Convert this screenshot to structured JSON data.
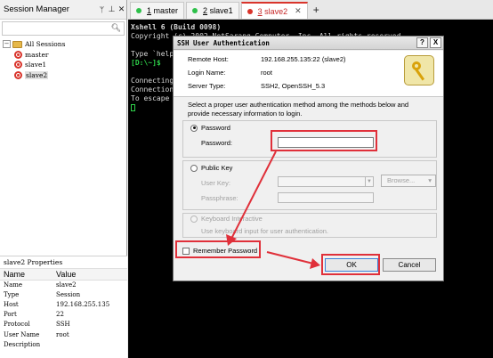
{
  "session_manager": {
    "title": "Session Manager",
    "pin_glyph": "ᛘ",
    "pin2_glyph": "⊥",
    "close_glyph": "✕",
    "search_placeholder": "",
    "tree": {
      "root_label": "All Sessions",
      "root_expander": "−",
      "items": [
        {
          "label": "master",
          "selected": false
        },
        {
          "label": "slave1",
          "selected": false
        },
        {
          "label": "slave2",
          "selected": true
        }
      ]
    },
    "properties": {
      "title": "slave2 Properties",
      "col_name": "Name",
      "col_value": "Value",
      "rows": [
        {
          "name": "Name",
          "value": "slave2"
        },
        {
          "name": "Type",
          "value": "Session"
        },
        {
          "name": "Host",
          "value": "192.168.255.135"
        },
        {
          "name": "Port",
          "value": "22"
        },
        {
          "name": "Protocol",
          "value": "SSH"
        },
        {
          "name": "User Name",
          "value": "root"
        },
        {
          "name": "Description",
          "value": ""
        }
      ]
    }
  },
  "tabs": [
    {
      "number": "1",
      "name": "master",
      "dot_color": "#2ec04a",
      "active": false
    },
    {
      "number": "2",
      "name": "slave1",
      "dot_color": "#2ec04a",
      "active": false
    },
    {
      "number": "3",
      "name": "slave2",
      "dot_color": "#d9342b",
      "active": true
    }
  ],
  "tab_add": "+",
  "tab_close_glyph": "✕",
  "terminal": {
    "lines": [
      {
        "text": "Xshell 6 (Build 0098)",
        "style": "bold"
      },
      {
        "text": "Copyright (c) 2002 NetSarang Computer, Inc. All rights reserved.",
        "style": ""
      },
      {
        "text": "",
        "style": ""
      },
      {
        "text": "Type `help' to learn how to use Xshell prompt.",
        "style": ""
      },
      {
        "text": "[D:\\~]$",
        "style": "green"
      },
      {
        "text": "",
        "style": ""
      },
      {
        "text": "Connecting to 192.168.255.135:22...",
        "style": ""
      },
      {
        "text": "Connection established.",
        "style": ""
      },
      {
        "text": "To escape to local shell, press 'Ctrl+Alt+]'.",
        "style": ""
      }
    ]
  },
  "dialog": {
    "title": "SSH User Authentication",
    "help_glyph": "?",
    "close_glyph": "X",
    "remote_host_label": "Remote Host:",
    "remote_host_value": "192.168.255.135:22 (slave2)",
    "login_name_label": "Login Name:",
    "login_name_value": "root",
    "server_type_label": "Server Type:",
    "server_type_value": "SSH2, OpenSSH_5.3",
    "instructions": "Select a proper user authentication method among the methods below and provide necessary information to login.",
    "password_option": "Password",
    "password_label": "Password:",
    "password_value": "",
    "public_key_option": "Public Key",
    "user_key_label": "User Key:",
    "passphrase_label": "Passphrase:",
    "browse_label": "Browse...",
    "browse_arrow": "▾",
    "keyboard_option": "Keyboard Interactive",
    "keyboard_desc": "Use keyboard input for user authentication.",
    "remember_label": "Remember Password",
    "ok_label": "OK",
    "cancel_label": "Cancel"
  },
  "colors": {
    "annotation": "#e0303a",
    "prompt_green": "#2ed24a"
  }
}
